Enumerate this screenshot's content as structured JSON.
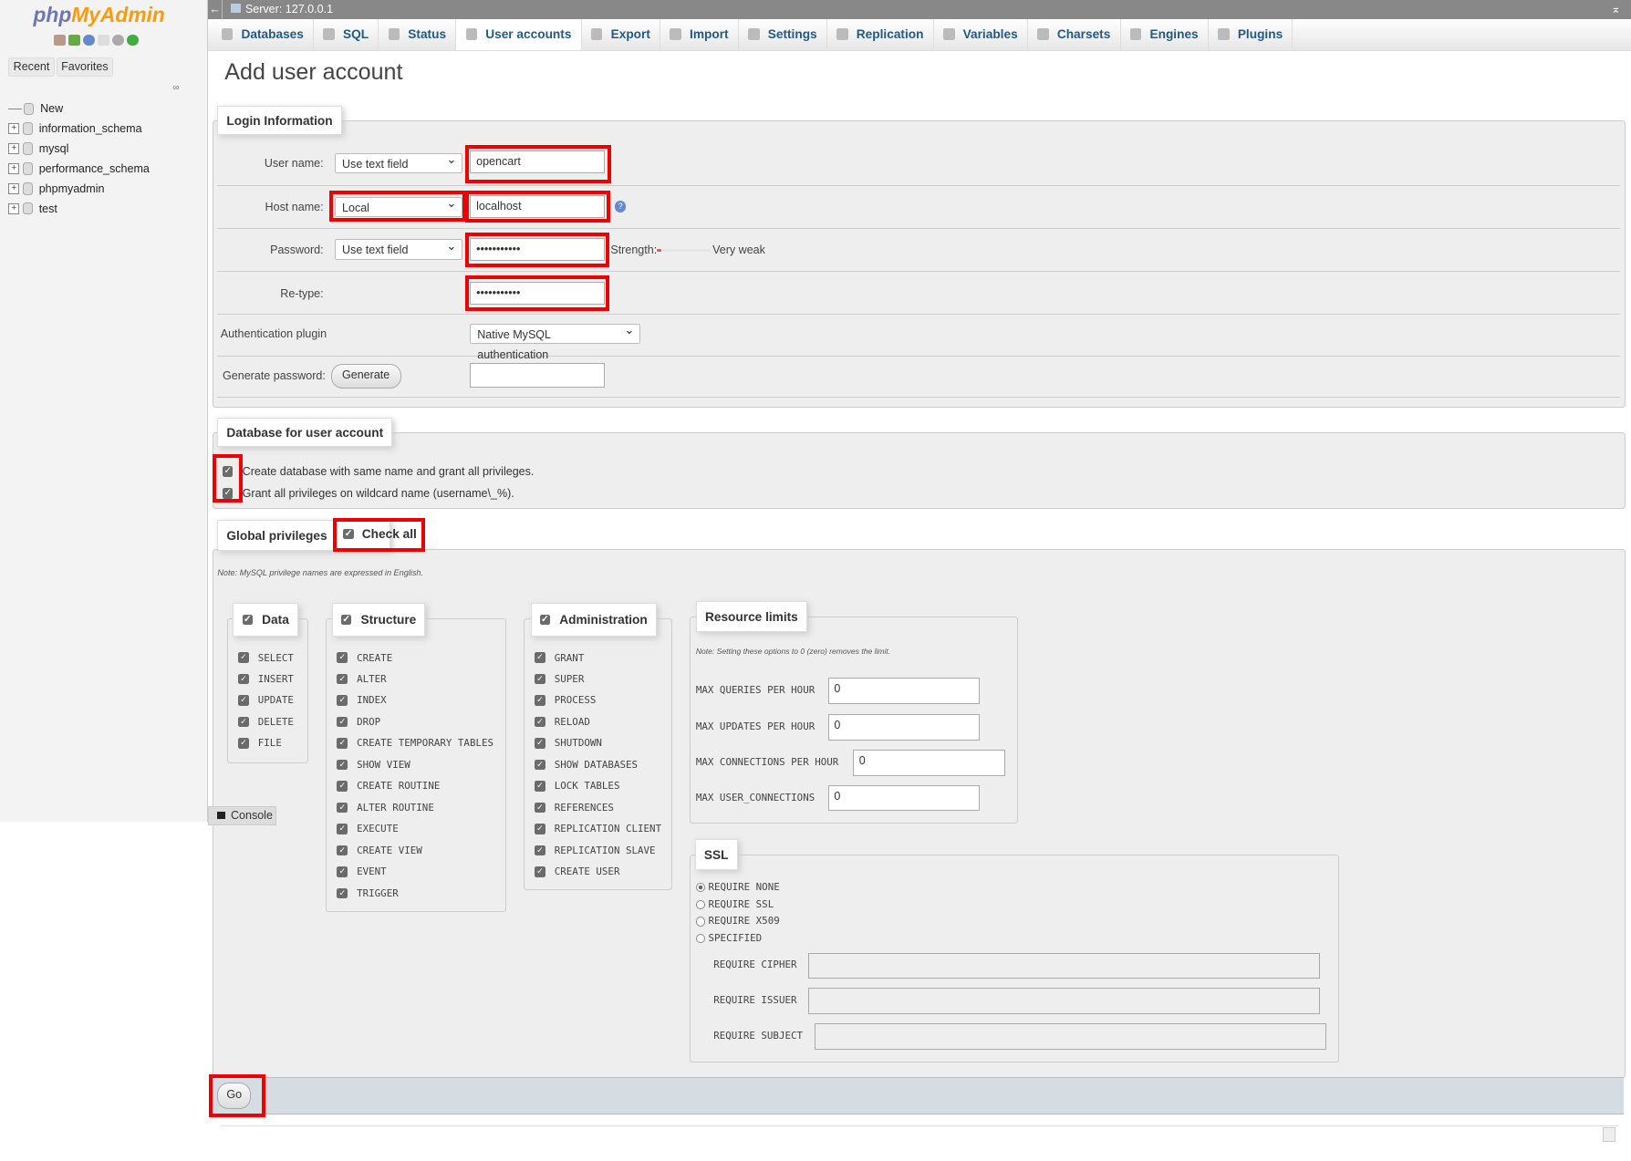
{
  "sidebar": {
    "logo": "phpMyAdmin",
    "recent": "Recent",
    "favorites": "Favorites",
    "tree": [
      {
        "label": "New"
      },
      {
        "label": "information_schema"
      },
      {
        "label": "mysql"
      },
      {
        "label": "performance_schema"
      },
      {
        "label": "phpmyadmin"
      },
      {
        "label": "test"
      }
    ]
  },
  "serverbar": {
    "title": "Server: 127.0.0.1"
  },
  "tabs": [
    {
      "label": "Databases"
    },
    {
      "label": "SQL"
    },
    {
      "label": "Status"
    },
    {
      "label": "User accounts",
      "active": true
    },
    {
      "label": "Export"
    },
    {
      "label": "Import"
    },
    {
      "label": "Settings"
    },
    {
      "label": "Replication"
    },
    {
      "label": "Variables"
    },
    {
      "label": "Charsets"
    },
    {
      "label": "Engines"
    },
    {
      "label": "Plugins"
    }
  ],
  "page_title": "Add user account",
  "login": {
    "legend": "Login Information",
    "username_label": "User name:",
    "username_mode": "Use text field",
    "username": "opencart",
    "host_label": "Host name:",
    "host_mode": "Local",
    "host": "localhost",
    "password_label": "Password:",
    "password_mode": "Use text field",
    "password": "•••••••••••",
    "strength_label": "Strength:",
    "strength": "Very weak",
    "strength_level": 0.1,
    "retype_label": "Re-type:",
    "retype": "•••••••••••",
    "auth_label": "Authentication plugin",
    "auth": "Native MySQL authentication",
    "generate_label": "Generate password:",
    "generate_button": "Generate",
    "generated": ""
  },
  "database": {
    "legend": "Database for user account",
    "options": [
      {
        "label": "Create database with same name and grant all privileges.",
        "checked": true
      },
      {
        "label": "Grant all privileges on wildcard name (username\\_%).",
        "checked": true
      }
    ]
  },
  "global": {
    "legend": "Global privileges",
    "check_all": "Check all",
    "note": "Note: MySQL privilege names are expressed in English.",
    "data": {
      "legend": "Data",
      "items": [
        "SELECT",
        "INSERT",
        "UPDATE",
        "DELETE",
        "FILE"
      ]
    },
    "structure": {
      "legend": "Structure",
      "items": [
        "CREATE",
        "ALTER",
        "INDEX",
        "DROP",
        "CREATE TEMPORARY TABLES",
        "SHOW VIEW",
        "CREATE ROUTINE",
        "ALTER ROUTINE",
        "EXECUTE",
        "CREATE VIEW",
        "EVENT",
        "TRIGGER"
      ]
    },
    "admin": {
      "legend": "Administration",
      "items": [
        "GRANT",
        "SUPER",
        "PROCESS",
        "RELOAD",
        "SHUTDOWN",
        "SHOW DATABASES",
        "LOCK TABLES",
        "REFERENCES",
        "REPLICATION CLIENT",
        "REPLICATION SLAVE",
        "CREATE USER"
      ]
    }
  },
  "limits": {
    "legend": "Resource limits",
    "note": "Note: Setting these options to 0 (zero) removes the limit.",
    "items": [
      {
        "label": "MAX QUERIES PER HOUR",
        "value": "0"
      },
      {
        "label": "MAX UPDATES PER HOUR",
        "value": "0"
      },
      {
        "label": "MAX CONNECTIONS PER HOUR",
        "value": "0"
      },
      {
        "label": "MAX USER_CONNECTIONS",
        "value": "0"
      }
    ]
  },
  "ssl": {
    "legend": "SSL",
    "options": [
      {
        "label": "REQUIRE NONE",
        "selected": true
      },
      {
        "label": "REQUIRE SSL"
      },
      {
        "label": "REQUIRE X509"
      },
      {
        "label": "SPECIFIED"
      }
    ],
    "fields": [
      {
        "label": "REQUIRE CIPHER",
        "value": ""
      },
      {
        "label": "REQUIRE ISSUER",
        "value": ""
      },
      {
        "label": "REQUIRE SUBJECT",
        "value": ""
      }
    ]
  },
  "console": "Console",
  "go": "Go",
  "colors": {
    "highlight": "#ee0000",
    "tab_text": "#235a81",
    "server_bar": "#888888"
  }
}
